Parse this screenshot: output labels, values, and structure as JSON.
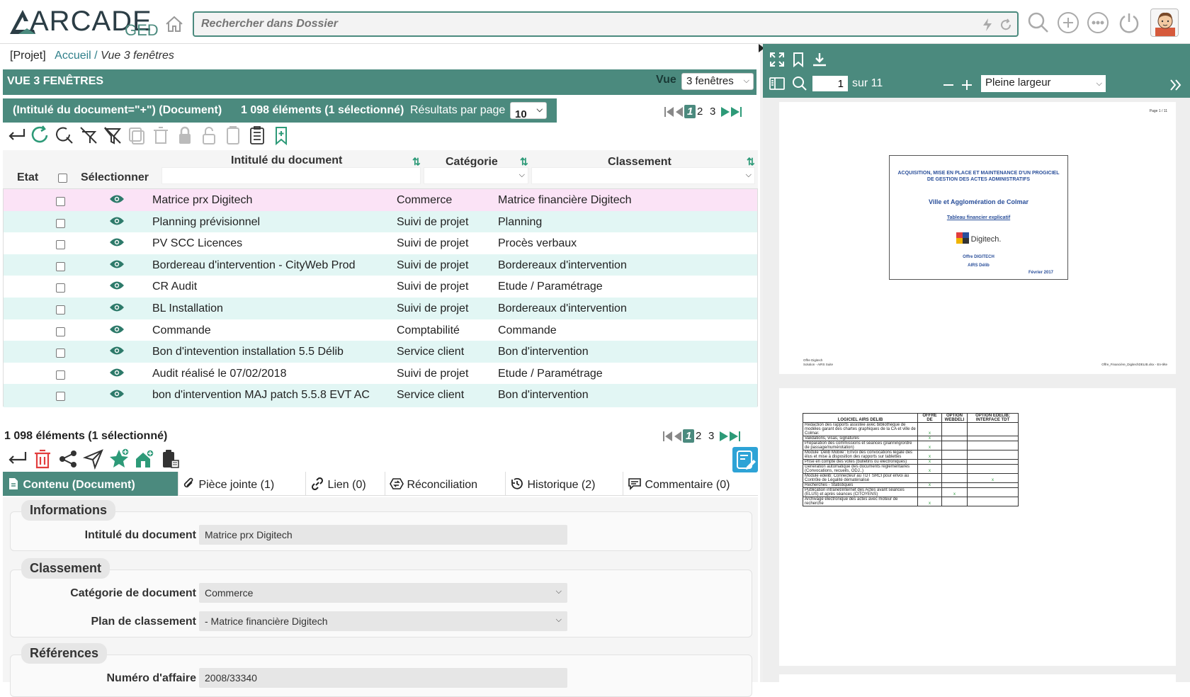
{
  "app": {
    "logo_text": "ARCADE",
    "logo_suffix": "GED",
    "search_placeholder": "Rechercher dans Dossier"
  },
  "breadcrumb": {
    "project": "[Projet]",
    "home": "Accueil",
    "separator": " / ",
    "current": "Vue 3 fenêtres"
  },
  "view_header": {
    "title": "VUE 3 FENÊTRES",
    "vue_label": "Vue",
    "vue_value": "3 fenêtres"
  },
  "query_bar": {
    "query": "(Intitulé du document=\"+\") (Document)",
    "count": "1 098 éléments (1 sélectionné)",
    "per_page_label": "Résultats par page",
    "per_page_value": "10"
  },
  "pager": {
    "pages": [
      "1",
      "2",
      "3"
    ],
    "current": "1"
  },
  "columns": {
    "etat": "Etat",
    "selectionner": "Sélectionner",
    "intitule": "Intitulé du document",
    "categorie": "Catégorie",
    "classement": "Classement"
  },
  "rows": [
    {
      "intitule": "Matrice prx Digitech",
      "categorie": "Commerce",
      "classement": "Matrice financière Digitech"
    },
    {
      "intitule": "Planning prévisionnel",
      "categorie": "Suivi de projet",
      "classement": "Planning"
    },
    {
      "intitule": "PV SCC Licences",
      "categorie": "Suivi de projet",
      "classement": "Procès verbaux"
    },
    {
      "intitule": "Bordereau d'intervention - CityWeb Prod",
      "categorie": "Suivi de projet",
      "classement": "Bordereaux d'intervention"
    },
    {
      "intitule": "CR Audit",
      "categorie": "Suivi de projet",
      "classement": "Etude / Paramétrage"
    },
    {
      "intitule": "BL Installation",
      "categorie": "Suivi de projet",
      "classement": "Bordereaux d'intervention"
    },
    {
      "intitule": "Commande",
      "categorie": "Comptabilité",
      "classement": "Commande"
    },
    {
      "intitule": "Bon d'intevention installation 5.5 Délib",
      "categorie": "Service client",
      "classement": "Bon d'intervention"
    },
    {
      "intitule": "Audit réalisé le 07/02/2018",
      "categorie": "Suivi de projet",
      "classement": "Etude / Paramétrage"
    },
    {
      "intitule": "bon d'intervention MAJ patch 5.5.8 EVT AC",
      "categorie": "Service client",
      "classement": "Bon d'intervention"
    }
  ],
  "footer_count": "1 098 éléments (1 sélectionné)",
  "tabs": [
    {
      "label": "Contenu (Document)"
    },
    {
      "label": "Pièce jointe (1)"
    },
    {
      "label": "Lien (0)"
    },
    {
      "label": "Réconciliation"
    },
    {
      "label": "Historique (2)"
    },
    {
      "label": "Commentaire (0)"
    }
  ],
  "form": {
    "informations": {
      "title": "Informations",
      "intitule_label": "Intitulé du document",
      "intitule_value": "Matrice prx Digitech"
    },
    "classement": {
      "title": "Classement",
      "categorie_label": "Catégorie de document",
      "categorie_value": "Commerce",
      "plan_label": "Plan de classement",
      "plan_value": "- Matrice financière Digitech"
    },
    "references": {
      "title": "Références",
      "numero_label": "Numéro d'affaire",
      "numero_value": "2008/33340"
    }
  },
  "viewer": {
    "page": "1",
    "of_label": "sur 11",
    "zoom": "Pleine largeur"
  },
  "pdf_page1": {
    "page_no": "Page 1 / 11",
    "title": "ACQUISITION, MISE EN PLACE ET MAINTENANCE D'UN PROGICIEL DE GESTION DES ACTES ADMINISTRATIFS",
    "client": "Ville et Agglomération de Colmar",
    "subtitle": "Tableau financier explicatif",
    "company": "Digitech.",
    "offer": "Offre DIGITECH",
    "product": "AIRS Délib",
    "date": "Février 2017",
    "footer_left1": "Offre Digitech",
    "footer_left2": "Solution - AIRS Suite",
    "footer_right": "Offre_Financière_DigitechDELIB.xlsx - En-tête"
  },
  "pdf_page2": {
    "headers": [
      "LOGICIEL AIRS DELIB",
      "OFFRE DE",
      "OPTION WEBDELI",
      "OPTION EDELIB; INTERFACE TDT"
    ],
    "rows": [
      {
        "label": "Rédaction des rapports assistée avec bibliothèque de modèles garant des chartes graphiques de la CA et ville de Colmar.",
        "marks": [
          "x",
          "",
          ""
        ]
      },
      {
        "label": "Validations, visas, signatures",
        "marks": [
          "x",
          "",
          ""
        ]
      },
      {
        "label": "Préparation des commissions et séances (planning/ordre de passage/numérotation)",
        "marks": [
          "x",
          "",
          ""
        ]
      },
      {
        "label": "Module 'Délib Mobile': Envoi des convocations légale des élus et mise à disposition des rapports sur tablettes",
        "marks": [
          "x",
          "",
          ""
        ]
      },
      {
        "label": "Prise en compte des votes (bulletins ou électroniques)",
        "marks": [
          "x",
          "",
          ""
        ]
      },
      {
        "label": "Génération automatique des documents réglementaires (Convocations, recueils, ODJ..)",
        "marks": [
          "x",
          "",
          ""
        ]
      },
      {
        "label": "Module edelib: Connecteur au TDT SRCI pour envoi au Contrôle de Légalité dématérialisé",
        "marks": [
          "",
          "",
          "x"
        ]
      },
      {
        "label": "Recherches - Statistiques",
        "marks": [
          "x",
          "",
          ""
        ]
      },
      {
        "label": "Publication intranet/internet des Actes avant séances (ELUS) et après séances (CITOYENS)",
        "marks": [
          "",
          "x",
          ""
        ]
      },
      {
        "label": "Archivage électronique des actes avec moteur de recherche",
        "marks": [
          "x",
          "",
          ""
        ]
      }
    ]
  },
  "colors": {
    "accent": "#4b8a7e",
    "selected_row": "#fbe3f6",
    "alt_row": "#e2f6f4",
    "danger": "#e23d3d"
  }
}
